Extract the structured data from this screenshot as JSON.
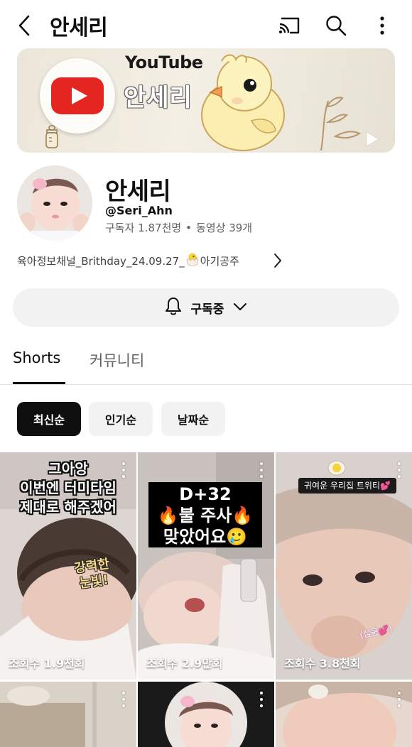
{
  "header": {
    "title": "안세리",
    "icons": [
      "back-arrow-icon",
      "cast-icon",
      "search-icon",
      "more-vert-icon"
    ]
  },
  "banner": {
    "brand": "YouTube",
    "name": "안세리"
  },
  "channel": {
    "name": "안세리",
    "handle": "@Seri_Ahn",
    "subscribers": "구독자 1.87천명",
    "dot": "•",
    "videos": "동영상 39개",
    "description_before": "육아정보채널_Brithday_24.09.27_",
    "description_after": "아기공주"
  },
  "subscribe": {
    "label": "구독중"
  },
  "tabs": [
    {
      "label": "Shorts",
      "active": true
    },
    {
      "label": "커뮤니티",
      "active": false
    }
  ],
  "filters": [
    {
      "label": "최신순",
      "active": true
    },
    {
      "label": "인기순",
      "active": false
    },
    {
      "label": "날짜순",
      "active": false
    }
  ],
  "shorts": [
    {
      "views": "조회수 1.9천회",
      "caption_lines": [
        "그아앙",
        "이번엔 터미타임",
        "제대로 해주겠어"
      ],
      "sticker_lines": [
        "강력한",
        "눈빛!"
      ]
    },
    {
      "views": "조회수 2.9만회",
      "caption_lines": [
        "D+32",
        "🔥불 주사🔥",
        "맞았어요🥲"
      ]
    },
    {
      "views": "조회수 3.8천회",
      "caption": "귀여운 우리집 트위티💕",
      "sticker": "(심쿵💕)"
    }
  ],
  "colors": {
    "accent": "#0f0f0f",
    "chip_bg": "#f2f2f2",
    "youtube_red": "#e52620"
  }
}
